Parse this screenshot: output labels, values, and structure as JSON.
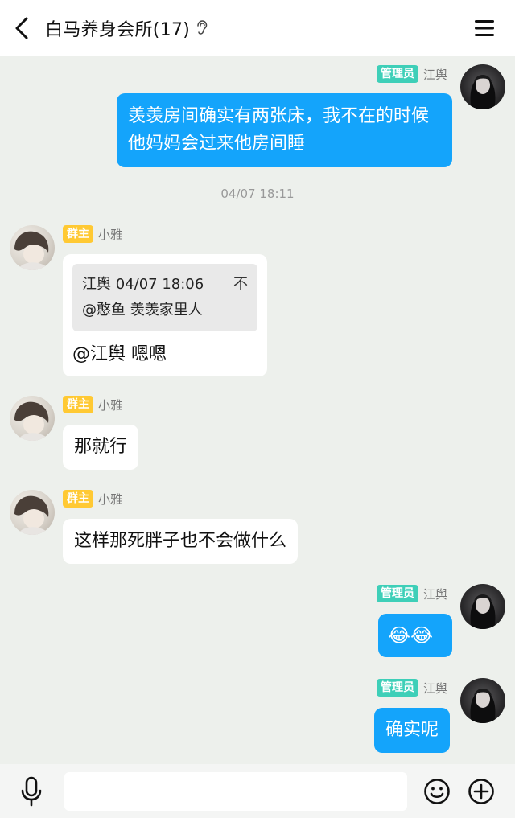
{
  "header": {
    "title": "白马养身会所(17)"
  },
  "messages": {
    "m1": {
      "badge": "管理员",
      "sender": "江舆",
      "text": "羡羡房间确实有两张床，我不在的时候他妈妈会过来他房间睡"
    },
    "timestamp": "04/07 18:11",
    "m2": {
      "badge": "群主",
      "sender": "小雅",
      "quote_header": "江舆 04/07 18:06",
      "quote_arrow": "不",
      "quote_text": "@憨鱼 羡羡家里人",
      "text": "@江舆 嗯嗯"
    },
    "m3": {
      "badge": "群主",
      "sender": "小雅",
      "text": "那就行"
    },
    "m4": {
      "badge": "群主",
      "sender": "小雅",
      "text": "这样那死胖子也不会做什么"
    },
    "m5": {
      "badge": "管理员",
      "sender": "江舆",
      "text": "😂😂"
    },
    "m6": {
      "badge": "管理员",
      "sender": "江舆",
      "text": "确实呢"
    }
  },
  "input": {
    "placeholder": ""
  },
  "colors": {
    "my_bubble": "#14a4fb",
    "admin_badge": "#3ecfb8",
    "owner_badge": "#ffc933",
    "chat_background": "#edf0ec"
  },
  "icons": [
    "back-arrow-icon",
    "ear-icon",
    "menu-icon",
    "microphone-icon",
    "emoji-icon",
    "plus-icon"
  ]
}
